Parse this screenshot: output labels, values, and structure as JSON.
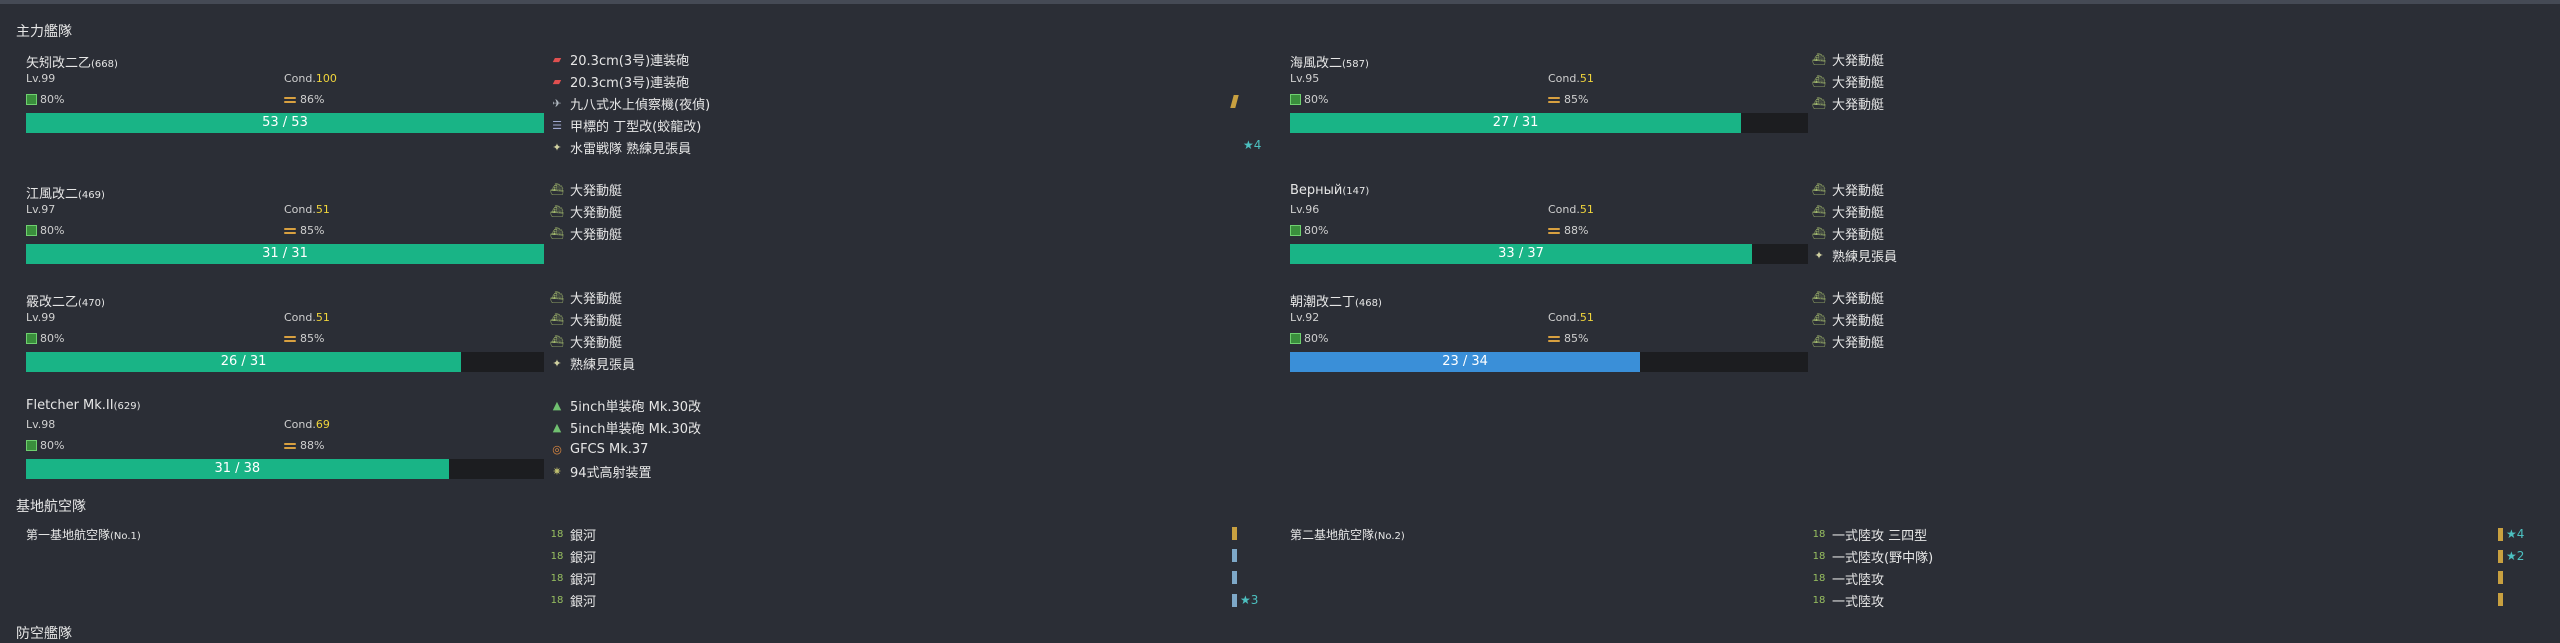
{
  "sections": {
    "main_fleet": "主力艦隊",
    "lbas": "基地航空隊",
    "defense": "防空艦隊"
  },
  "ships": [
    {
      "name": "矢矧改二乙",
      "id": "(668)",
      "lv": "Lv.99",
      "cond_label": "Cond.",
      "cond": "100",
      "fuel": "80%",
      "ammo": "86%",
      "hp": "53 / 53",
      "hp_ratio": 1.0,
      "hp_color": "#19b486"
    },
    {
      "name": "江風改二",
      "id": "(469)",
      "lv": "Lv.97",
      "cond_label": "Cond.",
      "cond": "51",
      "fuel": "80%",
      "ammo": "85%",
      "hp": "31 / 31",
      "hp_ratio": 1.0,
      "hp_color": "#19b486"
    },
    {
      "name": "霰改二乙",
      "id": "(470)",
      "lv": "Lv.99",
      "cond_label": "Cond.",
      "cond": "51",
      "fuel": "80%",
      "ammo": "85%",
      "hp": "26 / 31",
      "hp_ratio": 0.84,
      "hp_color": "#19b486"
    },
    {
      "name": "Fletcher Mk.II",
      "id": "(629)",
      "lv": "Lv.98",
      "cond_label": "Cond.",
      "cond": "69",
      "fuel": "80%",
      "ammo": "88%",
      "hp": "31 / 38",
      "hp_ratio": 0.816,
      "hp_color": "#19b486"
    },
    {
      "name": "海風改二",
      "id": "(587)",
      "lv": "Lv.95",
      "cond_label": "Cond.",
      "cond": "51",
      "fuel": "80%",
      "ammo": "85%",
      "hp": "27 / 31",
      "hp_ratio": 0.871,
      "hp_color": "#19b486"
    },
    {
      "name": "Верный",
      "id": "(147)",
      "lv": "Lv.96",
      "cond_label": "Cond.",
      "cond": "51",
      "fuel": "80%",
      "ammo": "88%",
      "hp": "33 / 37",
      "hp_ratio": 0.892,
      "hp_color": "#19b486"
    },
    {
      "name": "朝潮改二丁",
      "id": "(468)",
      "lv": "Lv.92",
      "cond_label": "Cond.",
      "cond": "51",
      "fuel": "80%",
      "ammo": "85%",
      "hp": "23 / 34",
      "hp_ratio": 0.676,
      "hp_color": "#3a8fd8"
    }
  ],
  "equips": [
    [
      {
        "icon": "gun-icon",
        "name": "20.3cm(3号)連装砲"
      },
      {
        "icon": "gun-icon",
        "name": "20.3cm(3号)連装砲"
      },
      {
        "icon": "plane-icon",
        "name": "九八式水上偵察機(夜偵)"
      },
      {
        "icon": "armor-icon",
        "name": "甲標的 丁型改(蛟龍改)"
      },
      {
        "icon": "crew-icon",
        "name": "水雷戦隊 熟練見張員"
      }
    ],
    [
      {
        "icon": "boat-icon",
        "name": "大発動艇"
      },
      {
        "icon": "boat-icon",
        "name": "大発動艇"
      },
      {
        "icon": "boat-icon",
        "name": "大発動艇"
      }
    ],
    [
      {
        "icon": "boat-icon",
        "name": "大発動艇"
      },
      {
        "icon": "boat-icon",
        "name": "大発動艇"
      },
      {
        "icon": "boat-icon",
        "name": "大発動艇"
      },
      {
        "icon": "crew-icon",
        "name": "熟練見張員"
      }
    ],
    [
      {
        "icon": "secondary-gun-icon",
        "name": "5inch単装砲 Mk.30改"
      },
      {
        "icon": "secondary-gun-icon",
        "name": "5inch単装砲 Mk.30改"
      },
      {
        "icon": "fcs-icon",
        "name": "GFCS Mk.37"
      },
      {
        "icon": "aa-icon",
        "name": "94式高射装置"
      }
    ],
    [
      {
        "icon": "boat-icon",
        "name": "大発動艇"
      },
      {
        "icon": "boat-icon",
        "name": "大発動艇"
      },
      {
        "icon": "boat-icon",
        "name": "大発動艇"
      }
    ],
    [
      {
        "icon": "boat-icon",
        "name": "大発動艇"
      },
      {
        "icon": "boat-icon",
        "name": "大発動艇"
      },
      {
        "icon": "boat-icon",
        "name": "大発動艇"
      },
      {
        "icon": "crew-icon",
        "name": "熟練見張員"
      }
    ],
    [
      {
        "icon": "boat-icon",
        "name": "大発動艇"
      },
      {
        "icon": "boat-icon",
        "name": "大発動艇"
      },
      {
        "icon": "boat-icon",
        "name": "大発動艇"
      }
    ]
  ],
  "ship_extras": {
    "star_yahagi": "★4"
  },
  "bases": [
    {
      "name": "第一基地航空隊",
      "id": "(No.1)",
      "slots": [
        {
          "lvl": "18",
          "name": "銀河",
          "star": ""
        },
        {
          "lvl": "18",
          "name": "銀河",
          "star": ""
        },
        {
          "lvl": "18",
          "name": "銀河",
          "star": ""
        },
        {
          "lvl": "18",
          "name": "銀河",
          "star": "★3"
        }
      ]
    },
    {
      "name": "第二基地航空隊",
      "id": "(No.2)",
      "slots": [
        {
          "lvl": "18",
          "name": "一式陸攻 三四型",
          "star": "★4"
        },
        {
          "lvl": "18",
          "name": "一式陸攻(野中隊)",
          "star": "★2"
        },
        {
          "lvl": "18",
          "name": "一式陸攻",
          "star": ""
        },
        {
          "lvl": "18",
          "name": "一式陸攻",
          "star": ""
        }
      ]
    }
  ],
  "colors": {
    "hp_green": "#19b486",
    "hp_blue": "#3a8fd8",
    "cond_yellow": "#f0d53c",
    "background": "#2b2e36"
  }
}
